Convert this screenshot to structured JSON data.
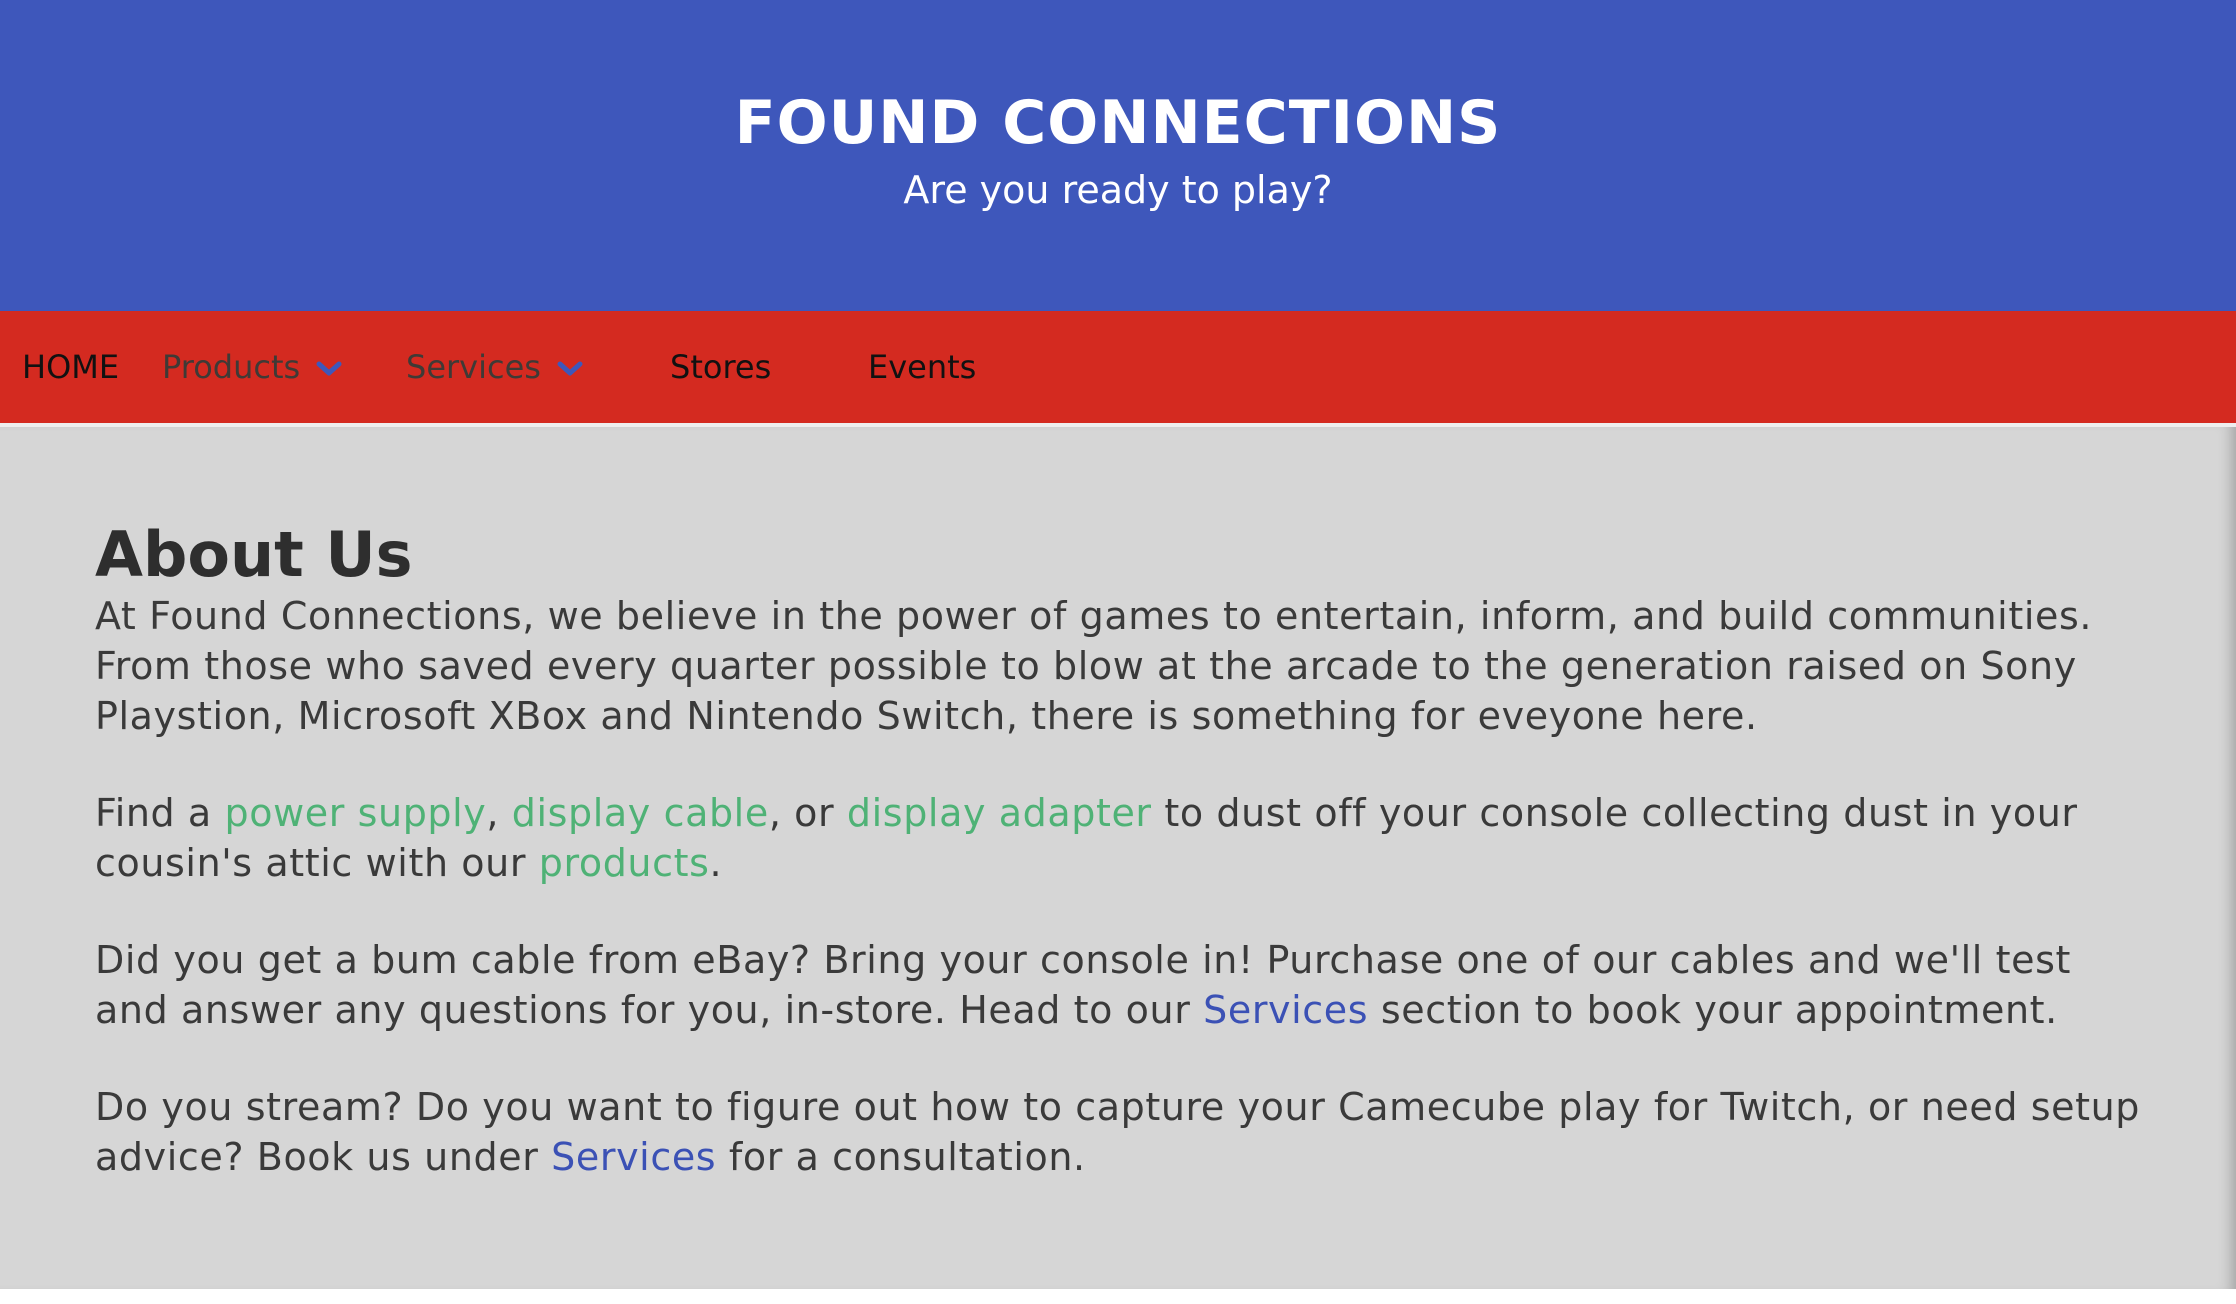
{
  "header": {
    "title": "FOUND CONNECTIONS",
    "tagline": "Are you ready to play?"
  },
  "nav": {
    "home": "HOME",
    "products": "Products",
    "services": "Services",
    "stores": "Stores",
    "events": "Events"
  },
  "colors": {
    "header_bg": "#3e57bb",
    "nav_bg": "#d42a20",
    "content_bg": "#d6d6d6",
    "link_green": "#4fb276",
    "link_blue": "#3b51b5"
  },
  "about": {
    "heading": "About Us",
    "p1": "At Found Connections, we believe in the power of games to entertain, inform, and build communities. From those who saved every quarter possible to blow at the arcade to the generation raised on Sony Playstion, Microsoft XBox and Nintendo Switch, there is something for eveyone here.",
    "p2": {
      "t1": "Find a ",
      "link_power": "power supply",
      "t2": ", ",
      "link_cable": "display cable",
      "t3": ", or ",
      "link_adapter": "display adapter",
      "t4": " to dust off your console collecting dust in your cousin's attic with our ",
      "link_products": "products",
      "t5": "."
    },
    "p3": {
      "t1": "Did you get a bum cable from eBay? Bring your console in! Purchase one of our cables and we'll test and answer any questions for you, in-store. Head to our ",
      "link_services": "Services",
      "t2": " section to book your appointment."
    },
    "p4": {
      "t1": "Do you stream? Do you want to figure out how to capture your Camecube play for Twitch, or need setup advice? Book us under ",
      "link_services": "Services",
      "t2": " for a consultation."
    }
  }
}
